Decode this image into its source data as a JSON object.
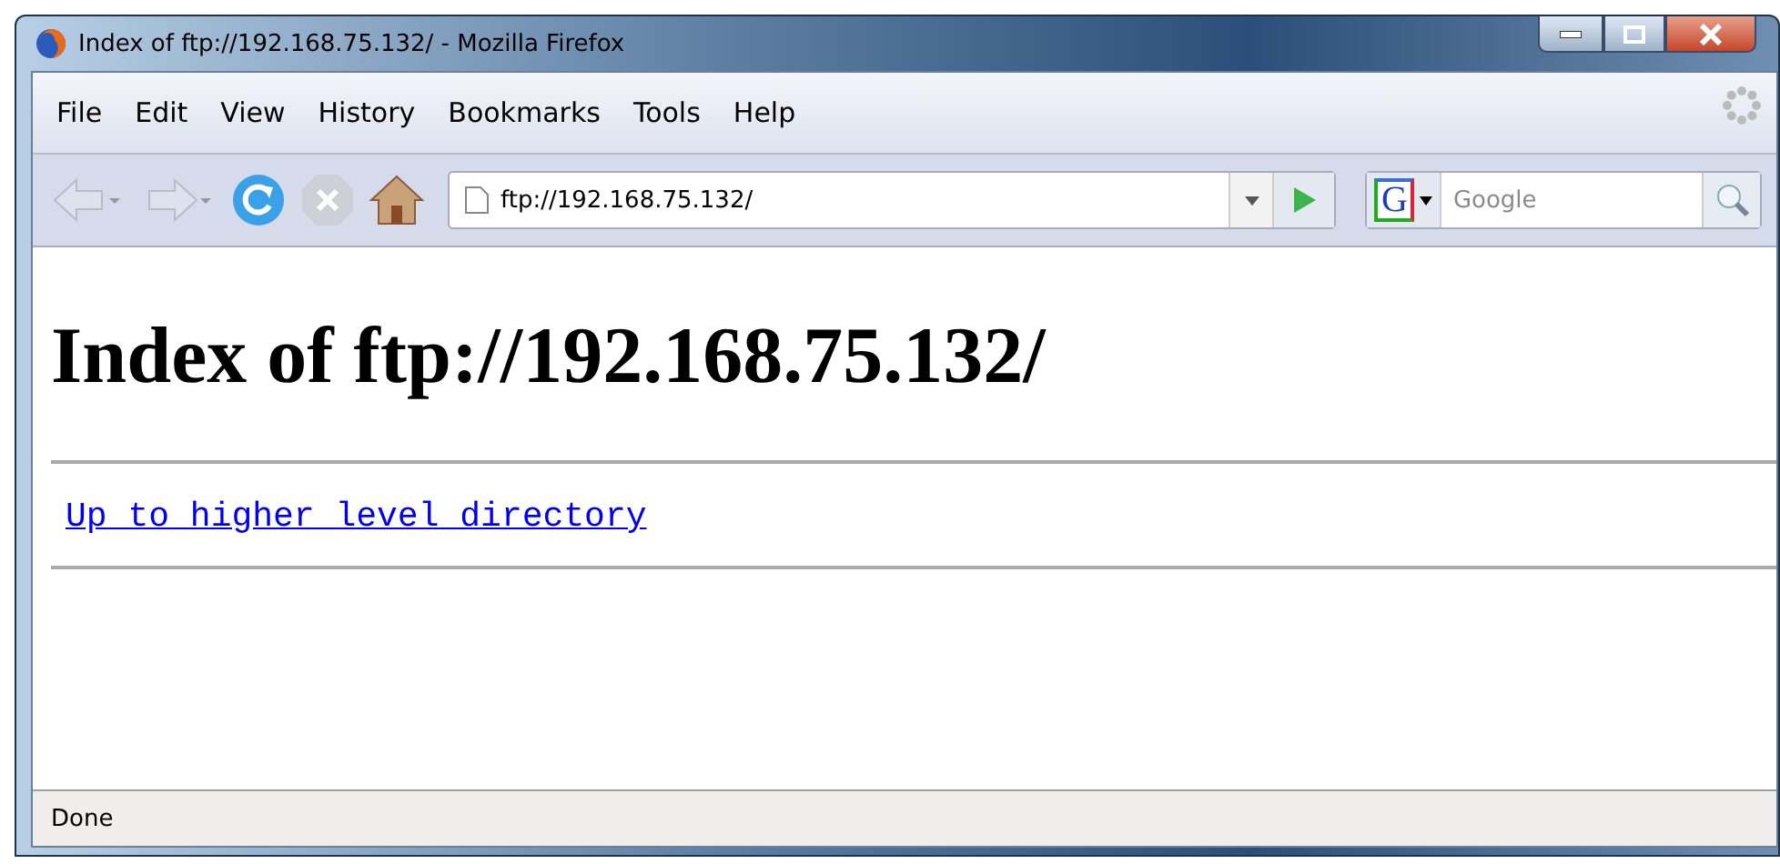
{
  "window": {
    "title": "Index of ftp://192.168.75.132/ - Mozilla Firefox"
  },
  "menu": [
    "File",
    "Edit",
    "View",
    "History",
    "Bookmarks",
    "Tools",
    "Help"
  ],
  "address_bar": {
    "value": "ftp://192.168.75.132/"
  },
  "search": {
    "engine_letter": "G",
    "placeholder": "Google"
  },
  "page": {
    "heading": "Index of ftp://192.168.75.132/",
    "link": "Up to higher level directory"
  },
  "status_bar": {
    "text": "Done"
  }
}
